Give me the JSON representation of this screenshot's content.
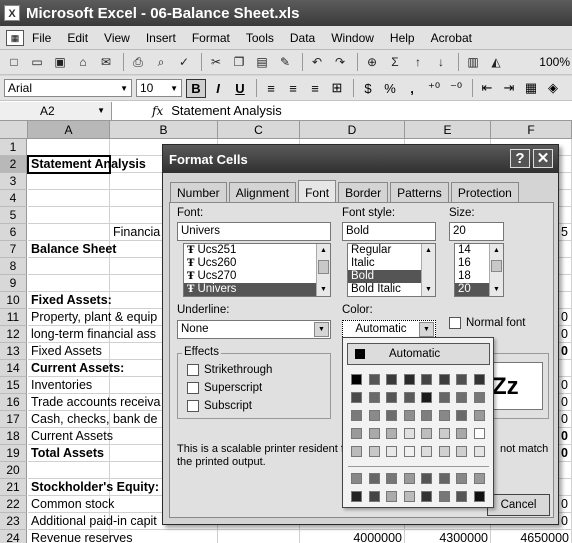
{
  "app": {
    "title": "Microsoft Excel - 06-Balance Sheet.xls",
    "icon": "excel-icon"
  },
  "menu": [
    "File",
    "Edit",
    "View",
    "Insert",
    "Format",
    "Tools",
    "Data",
    "Window",
    "Help",
    "Acrobat"
  ],
  "format_toolbar": {
    "font": "Arial",
    "size": "10",
    "bold": "B",
    "italic": "I",
    "underline": "U",
    "percent": "%",
    "comma": ",",
    "zoom": "100%"
  },
  "formula_bar": {
    "cell_ref": "A2",
    "fx": "fx",
    "content": "Statement Analysis"
  },
  "sheet": {
    "columns": [
      "A",
      "B",
      "C",
      "D",
      "E",
      "F"
    ],
    "rows": [
      "1",
      "2",
      "3",
      "4",
      "5",
      "6",
      "7",
      "8",
      "9",
      "10",
      "11",
      "12",
      "13",
      "14",
      "15",
      "16",
      "17",
      "18",
      "19",
      "20",
      "21",
      "22",
      "23",
      "24"
    ],
    "cells": [
      {
        "row": 2,
        "text": "Statement Analysis",
        "bold": true
      },
      {
        "row": 6,
        "text": "Financia",
        "bold": false,
        "col": "B"
      },
      {
        "row": 7,
        "text": "Balance Sheet",
        "bold": true
      },
      {
        "row": 10,
        "text": "Fixed Assets:",
        "bold": true
      },
      {
        "row": 11,
        "text": "Property, plant & equip",
        "bold": false
      },
      {
        "row": 12,
        "text": "long-term financial ass",
        "bold": false
      },
      {
        "row": 13,
        "text": "Fixed Assets",
        "bold": false
      },
      {
        "row": 14,
        "text": "Current Assets:",
        "bold": true
      },
      {
        "row": 15,
        "text": "Inventories",
        "bold": false
      },
      {
        "row": 16,
        "text": "Trade accounts receiva",
        "bold": false
      },
      {
        "row": 17,
        "text": "Cash, checks, bank de",
        "bold": false
      },
      {
        "row": 18,
        "text": "Current Assets",
        "bold": false
      },
      {
        "row": 19,
        "text": "Total Assets",
        "bold": true
      },
      {
        "row": 21,
        "text": "Stockholder's Equity:",
        "bold": true
      },
      {
        "row": 22,
        "text": "Common stock",
        "bold": false
      },
      {
        "row": 23,
        "text": "Additional paid-in capit",
        "bold": false
      },
      {
        "row": 24,
        "text": "Revenue reserves",
        "bold": false
      }
    ],
    "row24_values": [
      "4000000",
      "4300000",
      "4650000"
    ],
    "edge_digits": [
      {
        "row": 6,
        "text": "5",
        "bold": false
      },
      {
        "row": 11,
        "text": "0",
        "bold": false
      },
      {
        "row": 12,
        "text": "0",
        "bold": false
      },
      {
        "row": 13,
        "text": "0",
        "bold": true
      },
      {
        "row": 15,
        "text": "0",
        "bold": false
      },
      {
        "row": 16,
        "text": "0",
        "bold": false
      },
      {
        "row": 17,
        "text": "0",
        "bold": false
      },
      {
        "row": 18,
        "text": "0",
        "bold": true
      },
      {
        "row": 19,
        "text": "0",
        "bold": true
      },
      {
        "row": 22,
        "text": "0",
        "bold": false
      },
      {
        "row": 23,
        "text": "0",
        "bold": false
      }
    ]
  },
  "dialog": {
    "title": "Format Cells",
    "help": "?",
    "close": "✕",
    "tabs": [
      "Number",
      "Alignment",
      "Font",
      "Border",
      "Patterns",
      "Protection"
    ],
    "active_tab": "Font",
    "font": {
      "label": "Font:",
      "value": "Univers",
      "items": [
        "Ucs251",
        "Ucs260",
        "Ucs270",
        "Univers"
      ],
      "tt_glyph": "Ŧ"
    },
    "style": {
      "label": "Font style:",
      "value": "Bold",
      "items": [
        "Regular",
        "Italic",
        "Bold",
        "Bold Italic"
      ]
    },
    "size": {
      "label": "Size:",
      "value": "20",
      "items": [
        "14",
        "16",
        "18",
        "20"
      ]
    },
    "underline": {
      "label": "Underline:",
      "value": "None"
    },
    "color": {
      "label": "Color:",
      "value": "Automatic"
    },
    "normal_font": "Normal font",
    "effects": {
      "title": "Effects",
      "items": [
        "Strikethrough",
        "Superscript",
        "Subscript"
      ]
    },
    "preview_text": "Zz",
    "note_line1": "This is a scalable printer resident fo",
    "note_line1_tail": "not match",
    "note_line2": "the printed output.",
    "cancel": "Cancel"
  },
  "color_palette": {
    "automatic": "Automatic",
    "rows": [
      [
        "#000000",
        "#555555",
        "#3a3a3a",
        "#2a2a2a",
        "#444444",
        "#3c3c3c",
        "#505050",
        "#333333"
      ],
      [
        "#4a4a4a",
        "#6a6a6a",
        "#555555",
        "#5a5a5a",
        "#1a1a1a",
        "#666666",
        "#6e6e6e",
        "#777777"
      ],
      [
        "#7a7a7a",
        "#8a8a8a",
        "#6c6c6c",
        "#8e8e8e",
        "#7e7e7e",
        "#888888",
        "#6a6a6a",
        "#999999"
      ],
      [
        "#9a9a9a",
        "#aaaaaa",
        "#b0b0b0",
        "#e0e0e0",
        "#bdbdbd",
        "#cccccc",
        "#a8a8a8",
        "#ffffff"
      ],
      [
        "#bbbbbb",
        "#c8c8c8",
        "#e8e8e8",
        "#f0f0f0",
        "#dddddd",
        "#d0d0d0",
        "#cfcfcf",
        "#e4e4e4"
      ]
    ],
    "extra_rows": [
      [
        "#888888",
        "#666666",
        "#777777",
        "#9a9a9a",
        "#555555",
        "#666666",
        "#888888",
        "#999999"
      ],
      [
        "#222222",
        "#444444",
        "#aaaaaa",
        "#bbbbbb",
        "#333333",
        "#777777",
        "#555555",
        "#111111"
      ]
    ]
  }
}
